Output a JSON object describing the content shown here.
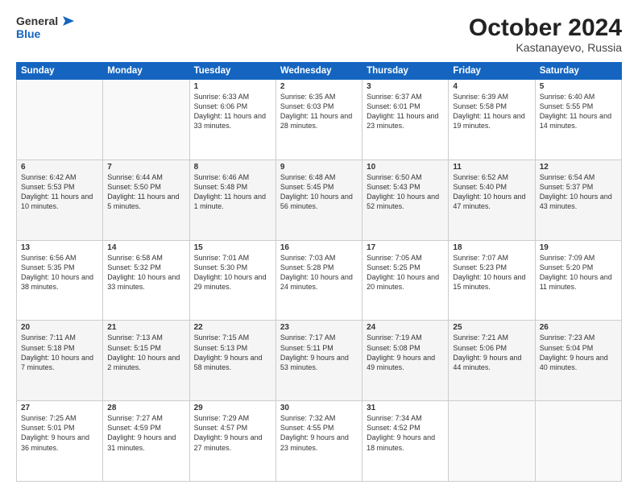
{
  "header": {
    "logo_line1": "General",
    "logo_line2": "Blue",
    "month": "October 2024",
    "location": "Kastanayevo, Russia"
  },
  "weekdays": [
    "Sunday",
    "Monday",
    "Tuesday",
    "Wednesday",
    "Thursday",
    "Friday",
    "Saturday"
  ],
  "weeks": [
    [
      {
        "day": "",
        "info": ""
      },
      {
        "day": "",
        "info": ""
      },
      {
        "day": "1",
        "info": "Sunrise: 6:33 AM\nSunset: 6:06 PM\nDaylight: 11 hours and 33 minutes."
      },
      {
        "day": "2",
        "info": "Sunrise: 6:35 AM\nSunset: 6:03 PM\nDaylight: 11 hours and 28 minutes."
      },
      {
        "day": "3",
        "info": "Sunrise: 6:37 AM\nSunset: 6:01 PM\nDaylight: 11 hours and 23 minutes."
      },
      {
        "day": "4",
        "info": "Sunrise: 6:39 AM\nSunset: 5:58 PM\nDaylight: 11 hours and 19 minutes."
      },
      {
        "day": "5",
        "info": "Sunrise: 6:40 AM\nSunset: 5:55 PM\nDaylight: 11 hours and 14 minutes."
      }
    ],
    [
      {
        "day": "6",
        "info": "Sunrise: 6:42 AM\nSunset: 5:53 PM\nDaylight: 11 hours and 10 minutes."
      },
      {
        "day": "7",
        "info": "Sunrise: 6:44 AM\nSunset: 5:50 PM\nDaylight: 11 hours and 5 minutes."
      },
      {
        "day": "8",
        "info": "Sunrise: 6:46 AM\nSunset: 5:48 PM\nDaylight: 11 hours and 1 minute."
      },
      {
        "day": "9",
        "info": "Sunrise: 6:48 AM\nSunset: 5:45 PM\nDaylight: 10 hours and 56 minutes."
      },
      {
        "day": "10",
        "info": "Sunrise: 6:50 AM\nSunset: 5:43 PM\nDaylight: 10 hours and 52 minutes."
      },
      {
        "day": "11",
        "info": "Sunrise: 6:52 AM\nSunset: 5:40 PM\nDaylight: 10 hours and 47 minutes."
      },
      {
        "day": "12",
        "info": "Sunrise: 6:54 AM\nSunset: 5:37 PM\nDaylight: 10 hours and 43 minutes."
      }
    ],
    [
      {
        "day": "13",
        "info": "Sunrise: 6:56 AM\nSunset: 5:35 PM\nDaylight: 10 hours and 38 minutes."
      },
      {
        "day": "14",
        "info": "Sunrise: 6:58 AM\nSunset: 5:32 PM\nDaylight: 10 hours and 33 minutes."
      },
      {
        "day": "15",
        "info": "Sunrise: 7:01 AM\nSunset: 5:30 PM\nDaylight: 10 hours and 29 minutes."
      },
      {
        "day": "16",
        "info": "Sunrise: 7:03 AM\nSunset: 5:28 PM\nDaylight: 10 hours and 24 minutes."
      },
      {
        "day": "17",
        "info": "Sunrise: 7:05 AM\nSunset: 5:25 PM\nDaylight: 10 hours and 20 minutes."
      },
      {
        "day": "18",
        "info": "Sunrise: 7:07 AM\nSunset: 5:23 PM\nDaylight: 10 hours and 15 minutes."
      },
      {
        "day": "19",
        "info": "Sunrise: 7:09 AM\nSunset: 5:20 PM\nDaylight: 10 hours and 11 minutes."
      }
    ],
    [
      {
        "day": "20",
        "info": "Sunrise: 7:11 AM\nSunset: 5:18 PM\nDaylight: 10 hours and 7 minutes."
      },
      {
        "day": "21",
        "info": "Sunrise: 7:13 AM\nSunset: 5:15 PM\nDaylight: 10 hours and 2 minutes."
      },
      {
        "day": "22",
        "info": "Sunrise: 7:15 AM\nSunset: 5:13 PM\nDaylight: 9 hours and 58 minutes."
      },
      {
        "day": "23",
        "info": "Sunrise: 7:17 AM\nSunset: 5:11 PM\nDaylight: 9 hours and 53 minutes."
      },
      {
        "day": "24",
        "info": "Sunrise: 7:19 AM\nSunset: 5:08 PM\nDaylight: 9 hours and 49 minutes."
      },
      {
        "day": "25",
        "info": "Sunrise: 7:21 AM\nSunset: 5:06 PM\nDaylight: 9 hours and 44 minutes."
      },
      {
        "day": "26",
        "info": "Sunrise: 7:23 AM\nSunset: 5:04 PM\nDaylight: 9 hours and 40 minutes."
      }
    ],
    [
      {
        "day": "27",
        "info": "Sunrise: 7:25 AM\nSunset: 5:01 PM\nDaylight: 9 hours and 36 minutes."
      },
      {
        "day": "28",
        "info": "Sunrise: 7:27 AM\nSunset: 4:59 PM\nDaylight: 9 hours and 31 minutes."
      },
      {
        "day": "29",
        "info": "Sunrise: 7:29 AM\nSunset: 4:57 PM\nDaylight: 9 hours and 27 minutes."
      },
      {
        "day": "30",
        "info": "Sunrise: 7:32 AM\nSunset: 4:55 PM\nDaylight: 9 hours and 23 minutes."
      },
      {
        "day": "31",
        "info": "Sunrise: 7:34 AM\nSunset: 4:52 PM\nDaylight: 9 hours and 18 minutes."
      },
      {
        "day": "",
        "info": ""
      },
      {
        "day": "",
        "info": ""
      }
    ]
  ]
}
